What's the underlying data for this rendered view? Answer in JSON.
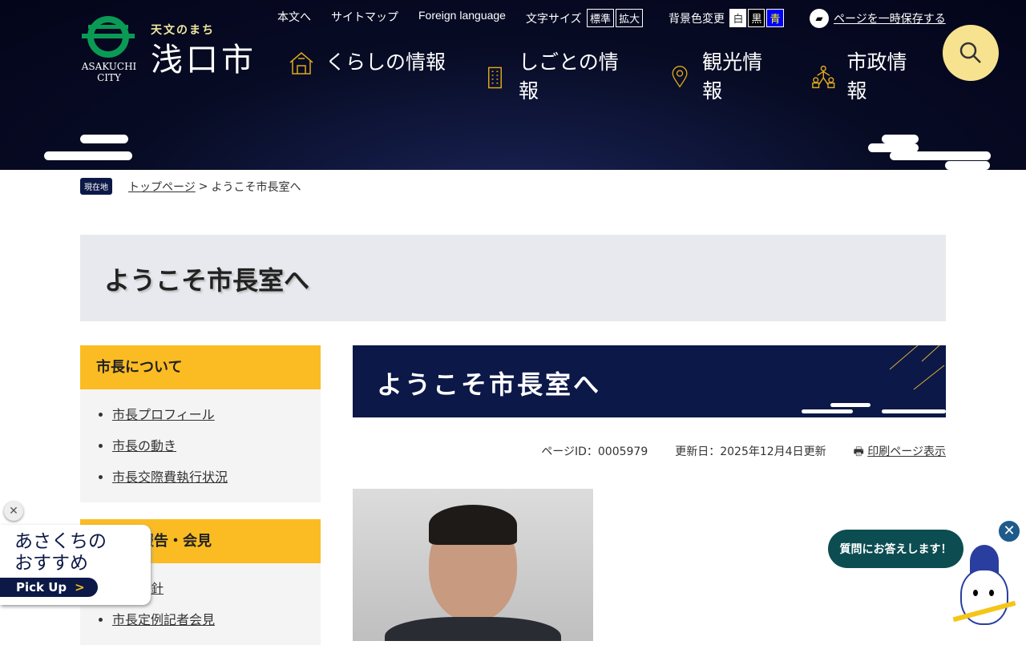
{
  "header": {
    "logo": {
      "tagline": "天文のまち",
      "name": "浅口市",
      "city_en": "ASAKUCHI CITY"
    },
    "util": {
      "skip": "本文へ",
      "sitemap": "サイトマップ",
      "foreign": "Foreign language",
      "font_size_label": "文字サイズ",
      "font_standard": "標準",
      "font_large": "拡大",
      "bg_label": "背景色変更",
      "bg_white": "白",
      "bg_black": "黒",
      "bg_blue": "青",
      "save_page": "ページを一時保存する"
    },
    "nav": [
      {
        "label": "くらしの情報",
        "icon": "house-icon"
      },
      {
        "label": "しごとの情報",
        "icon": "building-icon"
      },
      {
        "label": "観光情報",
        "icon": "map-pin-icon"
      },
      {
        "label": "市政情報",
        "icon": "people-icon"
      }
    ]
  },
  "breadcrumb": {
    "label": "現在地",
    "home": "トップページ",
    "sep": ">",
    "current": "ようこそ市長室へ"
  },
  "page_title": "ようこそ市長室へ",
  "sidebar": [
    {
      "heading": "市長について",
      "items": [
        "市長プロフィール",
        "市長の動き",
        "市長交際費執行状況"
      ]
    },
    {
      "heading": "市長の報告・会見",
      "items": [
        "施政方針",
        "市長定例記者会見"
      ]
    }
  ],
  "main": {
    "banner": "ようこそ市長室へ",
    "page_id": "ページID：0005979",
    "updated": "更新日：2025年12月4日更新",
    "print": "印刷ページ表示"
  },
  "pickup": {
    "line1": "あさくちの",
    "line2": "おすすめ",
    "button": "Pick Up"
  },
  "chatbot": {
    "bubble": "質問にお答えします！"
  }
}
